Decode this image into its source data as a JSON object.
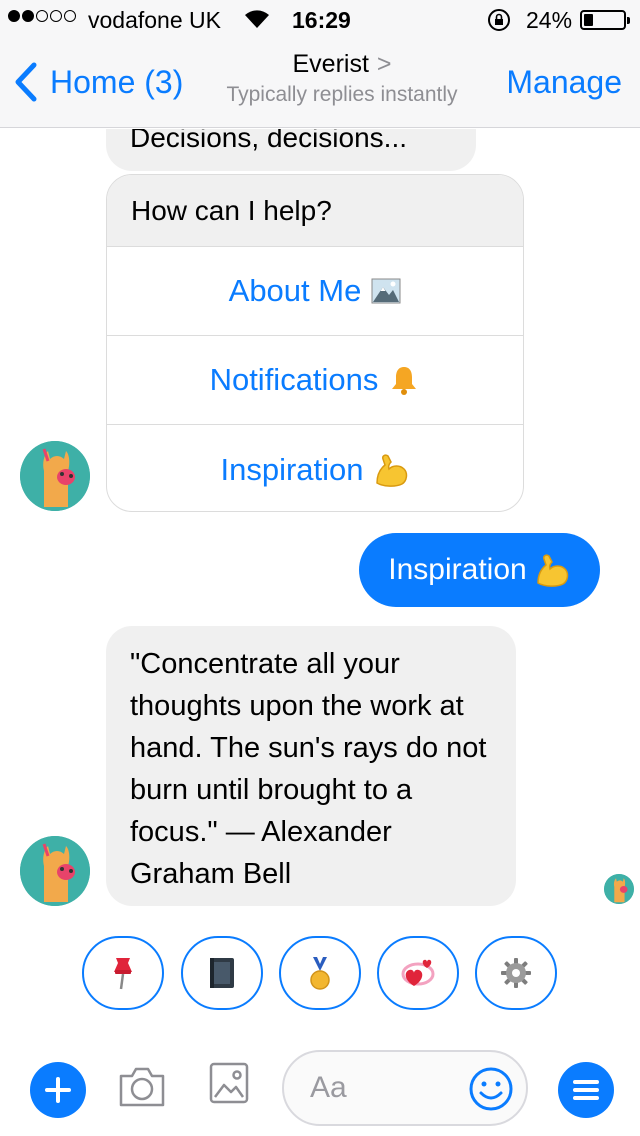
{
  "status_bar": {
    "carrier": "vodafone UK",
    "time": "16:29",
    "battery_percent": "24%",
    "battery_level": 0.24,
    "signal_bars_filled": 2,
    "signal_bars_total": 5
  },
  "nav": {
    "back_label": "Home (3)",
    "title": "Everist",
    "title_chevron": ">",
    "subtitle": "Typically replies instantly",
    "manage_label": "Manage"
  },
  "chat": {
    "partial_message": "Decisions, decisions...",
    "menu_card": {
      "header": "How can I help?",
      "buttons": [
        {
          "label": "About Me",
          "icon": "mountain-photo-icon"
        },
        {
          "label": "Notifications",
          "icon": "bell-icon"
        },
        {
          "label": "Inspiration",
          "icon": "flexed-biceps-icon"
        }
      ]
    },
    "sent_message": {
      "text": "Inspiration",
      "icon": "flexed-biceps-icon"
    },
    "quote_message": "\"Concentrate all your thoughts upon the work at hand. The sun's rays do not burn until brought to a focus.\" — Alexander Graham Bell"
  },
  "quick_replies": [
    {
      "icon": "pushpin-icon"
    },
    {
      "icon": "notebook-icon"
    },
    {
      "icon": "medal-icon"
    },
    {
      "icon": "revolving-hearts-icon"
    },
    {
      "icon": "gear-icon"
    }
  ],
  "composer": {
    "placeholder": "Aa"
  },
  "colors": {
    "accent": "#0a7cff",
    "bubble_gray": "#f0f0f0",
    "avatar_bg": "#3eb0a7"
  }
}
